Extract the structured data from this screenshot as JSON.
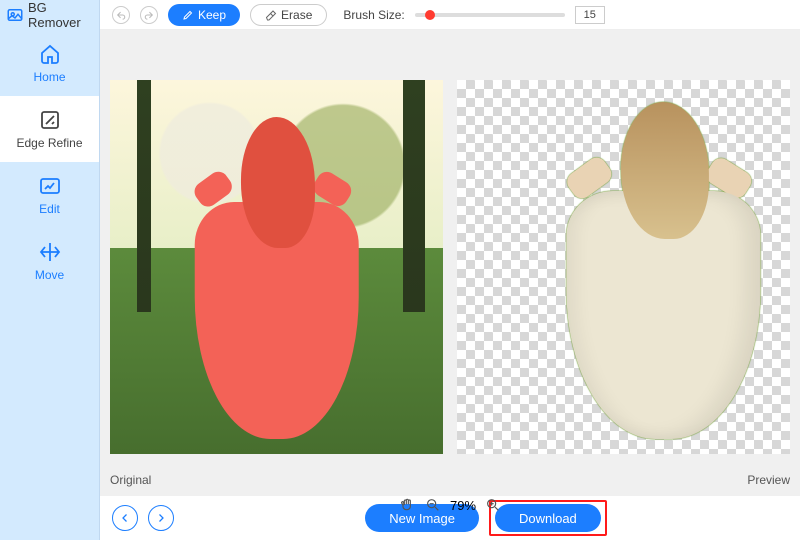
{
  "brand": {
    "name": "BG Remover"
  },
  "sidebar": {
    "items": [
      {
        "label": "Home"
      },
      {
        "label": "Edge Refine"
      },
      {
        "label": "Edit"
      },
      {
        "label": "Move"
      }
    ]
  },
  "toolbar": {
    "keep_label": "Keep",
    "erase_label": "Erase",
    "brush_label": "Brush Size:",
    "brush_value": "15"
  },
  "panes": {
    "original_label": "Original",
    "preview_label": "Preview"
  },
  "zoom": {
    "percent": "79%"
  },
  "bottom": {
    "new_image_label": "New Image",
    "download_label": "Download"
  },
  "icons": {
    "keep": "brush-icon",
    "erase": "eraser-icon"
  }
}
